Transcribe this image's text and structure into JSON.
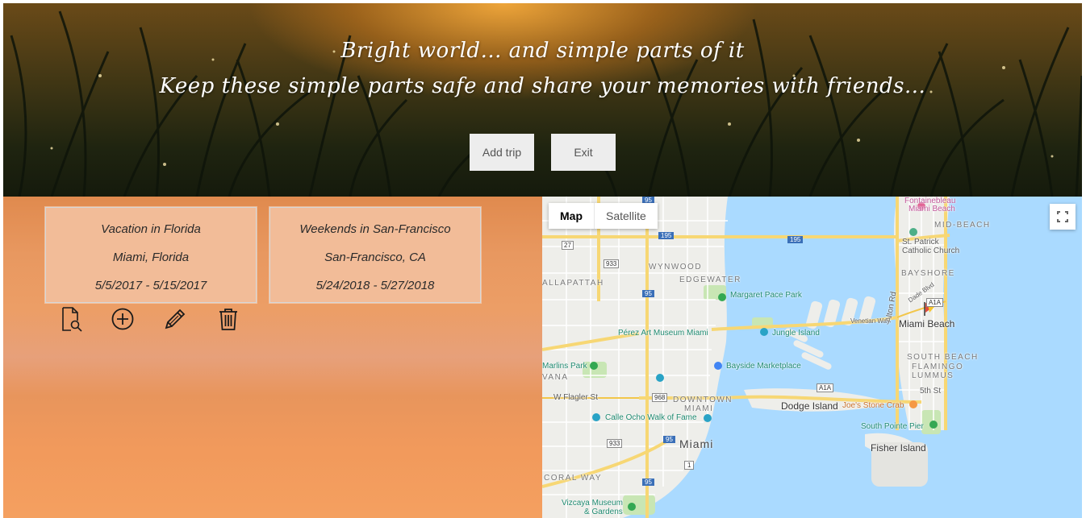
{
  "header": {
    "tagline_line1": "Bright world... and simple parts of it",
    "tagline_line2": "Keep these simple parts safe and share your memories with friends...",
    "add_trip_label": "Add trip",
    "exit_label": "Exit"
  },
  "trips": [
    {
      "title": "Vacation in Florida",
      "location": "Miami, Florida",
      "dates": "5/5/2017 - 5/15/2017"
    },
    {
      "title": "Weekends in San-Francisco",
      "location": "San-Francisco, CA",
      "dates": "5/24/2018 - 5/27/2018"
    }
  ],
  "trip_tools": {
    "view_icon": "document-search-icon",
    "add_icon": "plus-circle-icon",
    "edit_icon": "pencil-icon",
    "delete_icon": "trash-icon"
  },
  "map": {
    "type_map_label": "Map",
    "type_satellite_label": "Satellite",
    "fullscreen_icon": "fullscreen-icon",
    "labels": {
      "fontainebleau": "Fontainebleau",
      "miami_beach_poi": "Miami Beach",
      "mid_beach": "MID-BEACH",
      "st_patrick": "St. Patrick",
      "catholic_church": "Catholic Church",
      "bayshore": "BAYSHORE",
      "wynwood": "WYNWOOD",
      "edgewater": "EDGEWATER",
      "allapattah": "ALLAPATTAH",
      "margaret_pace_park": "Margaret Pace Park",
      "perez_art_museum": "Pérez Art Museum Miami",
      "jungle_island": "Jungle Island",
      "miami_beach_city": "Miami Beach",
      "south_beach": "SOUTH BEACH",
      "flamingo": "FLAMINGO",
      "lummus": "LUMMUS",
      "marlins_park": "Marlins Park",
      "havana": "VANA",
      "bayside_marketplace": "Bayside Marketplace",
      "w_flagler_st": "W Flagler St",
      "downtown_miami_1": "DOWNTOWN",
      "downtown_miami_2": "MIAMI",
      "dodge_island": "Dodge Island",
      "joes_stone_crab": "Joe's Stone Crab",
      "fifth_st": "5th St",
      "calle_ocho": "Calle Ocho Walk of Fame",
      "south_pointe_pier": "South Pointe Pier",
      "miami_city": "Miami",
      "fisher_island": "Fisher Island",
      "coral_way": "CORAL WAY",
      "vizcaya_1": "Vizcaya Museum",
      "vizcaya_2": "& Gardens",
      "alton_rd": "Alton Rd",
      "dade_blvd": "Dade Blvd",
      "venetian_way": "Venetian Way",
      "i195_a": "195",
      "i195_b": "195",
      "i95_a": "95",
      "i95_b": "95",
      "i95_c": "95",
      "i95_d": "95",
      "a1a_a": "A1A",
      "a1a_b": "A1A",
      "r27": "27",
      "r933_a": "933",
      "r933_b": "933",
      "r968": "968",
      "r1": "1"
    }
  }
}
